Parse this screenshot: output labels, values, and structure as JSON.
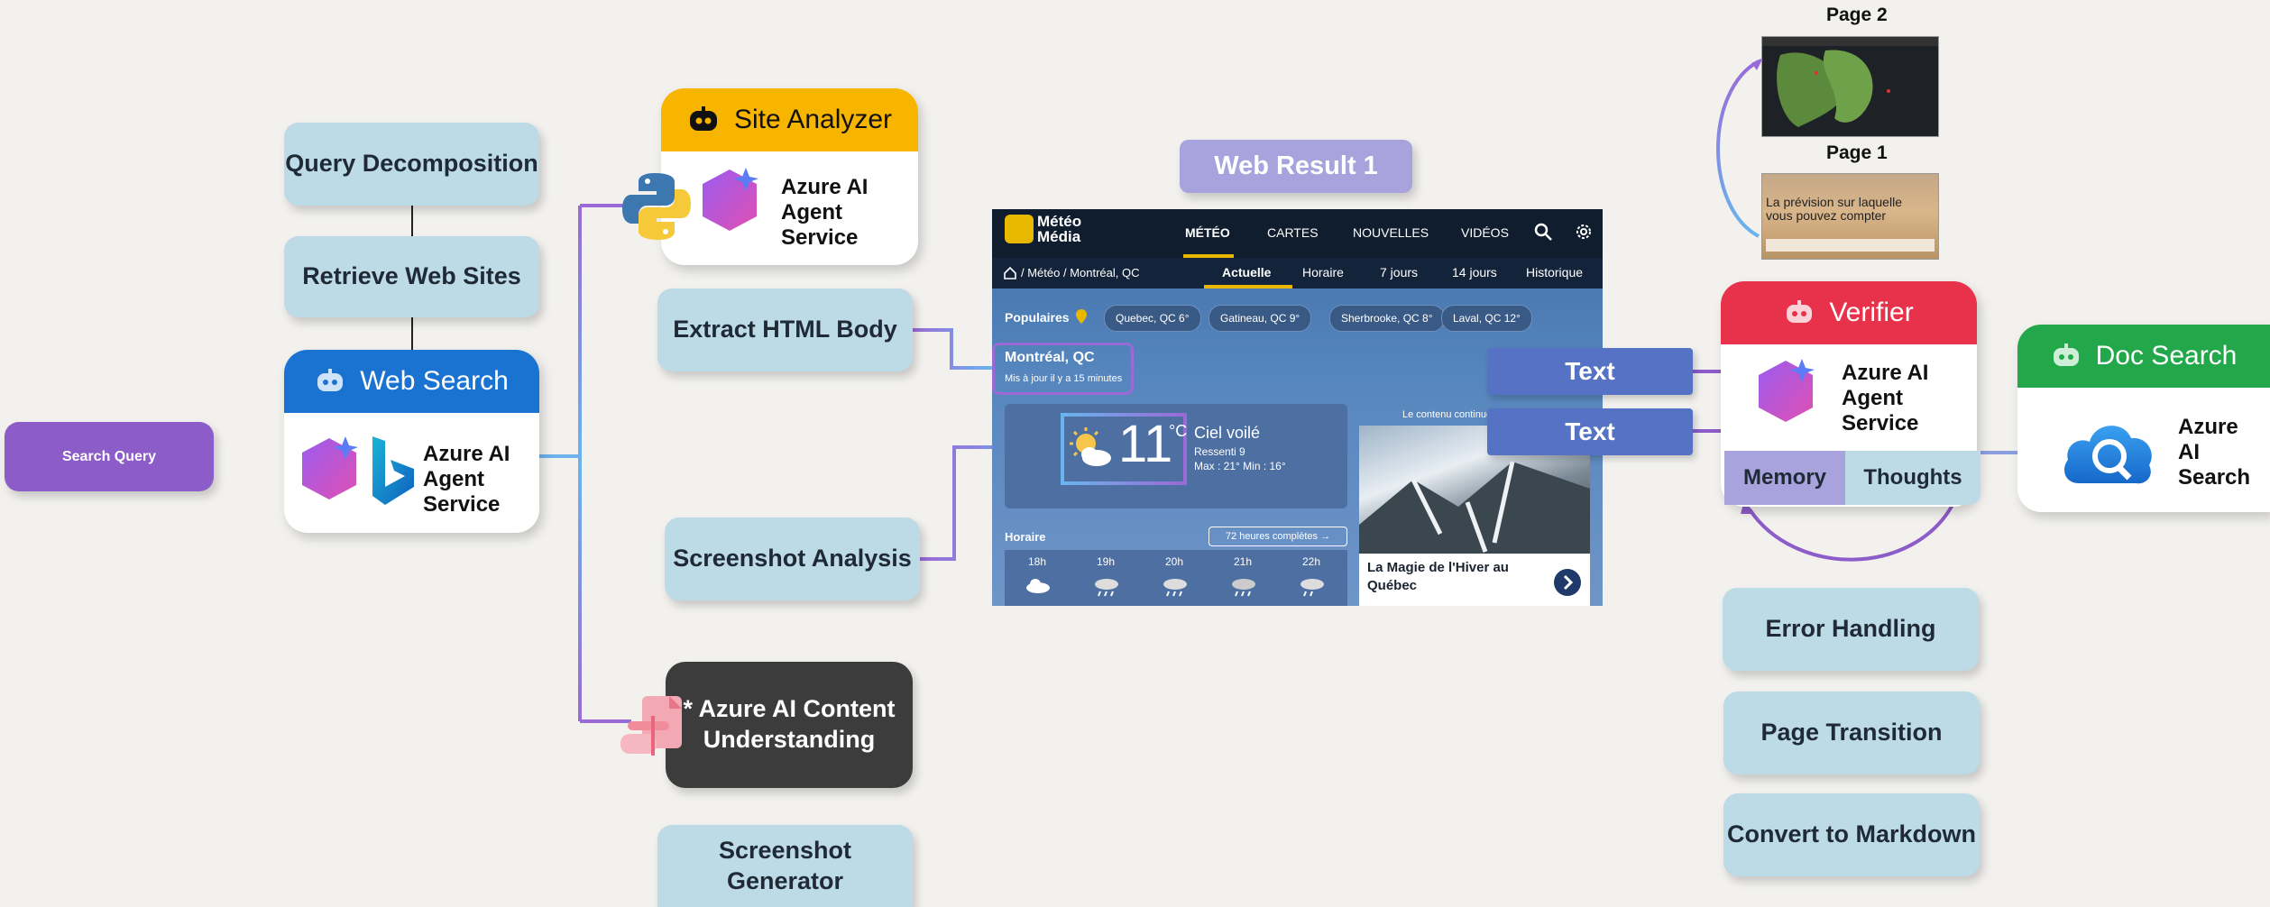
{
  "colors": {
    "purple": "#8c5cc8",
    "light_blue": "#bcdbe6",
    "web_search_header": "#1a73d0",
    "site_analyzer_header": "#f7b500",
    "verifier_header": "#e8314a",
    "doc_search_header": "#22a84a",
    "text_button": "#5572c4",
    "content_understanding": "#3c3c3c",
    "web_result": "#a8a3dd"
  },
  "search_query": "Search Query",
  "steps": {
    "query_decomposition": "Query Decomposition",
    "retrieve_web_sites": "Retrieve Web Sites",
    "extract_html_body": "Extract HTML Body",
    "screenshot_analysis": "Screenshot Analysis",
    "screenshot_generator": "Screenshot Generator",
    "error_handling": "Error Handling",
    "page_transition": "Page Transition",
    "convert_to_markdown": "Convert to Markdown"
  },
  "web_search": {
    "title": "Web Search",
    "service": "Azure AI Agent Service",
    "icons": [
      "agent-icon",
      "azure-ai-icon",
      "bing-icon"
    ]
  },
  "site_analyzer": {
    "title": "Site Analyzer",
    "service": "Azure AI Agent Service",
    "icons": [
      "agent-icon",
      "python-icon",
      "azure-ai-icon"
    ]
  },
  "content_understanding": {
    "label": "* Azure AI Content Understanding",
    "icon": "content-understanding-icon"
  },
  "web_result": "Web Result 1",
  "text_buttons": [
    "Text",
    "Text"
  ],
  "verifier": {
    "title": "Verifier",
    "service": "Azure AI Agent Service",
    "tabs": [
      "Memory",
      "Thoughts"
    ]
  },
  "doc_search": {
    "title": "Doc Search",
    "service": "Azure AI Search",
    "icon": "cloud-search-icon"
  },
  "pages": {
    "page2": "Page 2",
    "page1": "Page 1",
    "page1_text": "La prévision sur laquelle vous pouvez compter"
  },
  "website": {
    "logo_top": "Météo",
    "logo_bottom": "Média",
    "nav": [
      "MÉTÉO",
      "CARTES",
      "NOUVELLES",
      "VIDÉOS"
    ],
    "breadcrumb": "/ Météo / Montréal, QC",
    "subnav": [
      "Actuelle",
      "Horaire",
      "7 jours",
      "14 jours",
      "Historique"
    ],
    "populaires": "Populaires",
    "pills": [
      "Quebec, QC 6°",
      "Gatineau, QC 9°",
      "Sherbrooke, QC 8°",
      "Laval, QC 12°"
    ],
    "city": "Montréal, QC",
    "updated": "Mis à jour il y a 15 minutes",
    "temp": "11",
    "unit": "°C",
    "condition": "Ciel voilé",
    "feels": "Ressenti 9",
    "maxmin": "Max : 21°  Min : 16°",
    "horaire": "Horaire",
    "complete": "72 heures complètes →",
    "hours": [
      "18h",
      "19h",
      "20h",
      "21h",
      "22h"
    ],
    "continuing": "Le contenu continue",
    "article": "La Magie de l'Hiver au Québec"
  }
}
